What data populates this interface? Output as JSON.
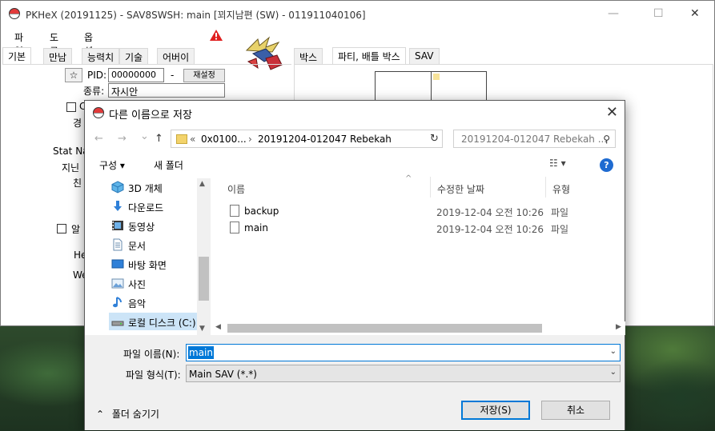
{
  "app": {
    "title": "PKHeX (20191125) - SAV8SWSH: main [꾀지남편 (SW) - 011911040106]",
    "menu": [
      "파일",
      "도구",
      "옵션"
    ],
    "left_tabs": [
      "기본",
      "만남",
      "능력치",
      "기술",
      "어버이"
    ],
    "right_tabs": [
      "박스",
      "파티, 배틀 박스",
      "SAV"
    ],
    "window_controls": {
      "minimize": "—",
      "maximize": "☐",
      "close": "✕"
    }
  },
  "pkm": {
    "star": "☆",
    "pid_label": "PID:",
    "pid_value": "00000000",
    "pid_dash": "-",
    "reset_button": "재설정",
    "species_label": "종류:",
    "species_value": "자시안",
    "partial_labels": {
      "exp": "경",
      "stat_nature": "Stat Na",
      "held": "지닌",
      "friendship": "친",
      "egg": "알",
      "height": "He",
      "weight": "We",
      "ability": "C"
    }
  },
  "dialog": {
    "title": "다른 이름으로 저장",
    "close": "✕",
    "nav": {
      "back": "←",
      "forward": "→",
      "recent": "⌄",
      "up": "↑"
    },
    "address": {
      "prefix": "«",
      "segments": [
        "0x0100...",
        "20191204-012047 Rebekah"
      ],
      "separator": "›",
      "dropdown": "⌄",
      "refresh": "↻"
    },
    "search_placeholder": "20191204-012047 Rebekah ...",
    "commands": {
      "organize": "구성 ▾",
      "new_folder": "새 폴더",
      "view": "☷ ▾",
      "help": "?"
    },
    "nav_items": [
      {
        "label": "3D 개체",
        "icon": "cube-3d-icon"
      },
      {
        "label": "다운로드",
        "icon": "download-icon"
      },
      {
        "label": "동영상",
        "icon": "video-icon"
      },
      {
        "label": "문서",
        "icon": "document-icon"
      },
      {
        "label": "바탕 화면",
        "icon": "desktop-icon"
      },
      {
        "label": "사진",
        "icon": "pictures-icon"
      },
      {
        "label": "음악",
        "icon": "music-icon"
      },
      {
        "label": "로컬 디스크 (C:)",
        "icon": "local-disk-icon"
      }
    ],
    "columns": [
      "이름",
      "수정한 날짜",
      "유형"
    ],
    "files": [
      {
        "name": "backup",
        "modified": "2019-12-04 오전 10:26",
        "type": "파일"
      },
      {
        "name": "main",
        "modified": "2019-12-04 오전 10:26",
        "type": "파일"
      }
    ],
    "filename_label": "파일 이름(N):",
    "filename_value": "main",
    "filetype_label": "파일 형식(T):",
    "filetype_value": "Main SAV (*.*)",
    "hide_folders": "폴더 숨기기",
    "save_button": "저장(S)",
    "cancel_button": "취소"
  },
  "colors": {
    "accent": "#0078d7",
    "selection": "#cce4f7",
    "warning": "#e02020"
  }
}
